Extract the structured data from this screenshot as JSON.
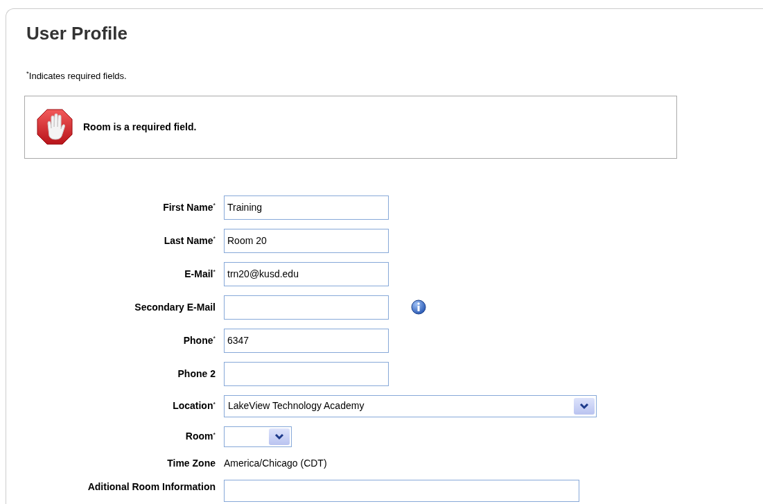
{
  "title": "User Profile",
  "note": {
    "mark": "*",
    "text": "Indicates required fields."
  },
  "alert": {
    "kind": "error",
    "message": "Room is a required field."
  },
  "fields": [
    {
      "kind": "text",
      "label": "First Name",
      "required": true,
      "value": "Training"
    },
    {
      "kind": "text",
      "label": "Last Name",
      "required": true,
      "value": "Room 20"
    },
    {
      "kind": "text",
      "label": "E-Mail",
      "required": true,
      "value": "trn20@kusd.edu"
    },
    {
      "kind": "text",
      "label": "Secondary E-Mail",
      "required": false,
      "info": true
    },
    {
      "kind": "text",
      "label": "Phone",
      "required": true,
      "value": "6347"
    },
    {
      "kind": "text",
      "label": "Phone 2",
      "required": false
    },
    {
      "kind": "select",
      "label": "Location",
      "required": true,
      "value": "LakeView Technology Academy"
    },
    {
      "kind": "shortselect",
      "label": "Room",
      "required": true
    },
    {
      "kind": "static",
      "label": "Time Zone",
      "required": false,
      "value": "America/Chicago (CDT)"
    },
    {
      "kind": "textarea",
      "label": "Aditional Room Information",
      "required": false
    }
  ]
}
